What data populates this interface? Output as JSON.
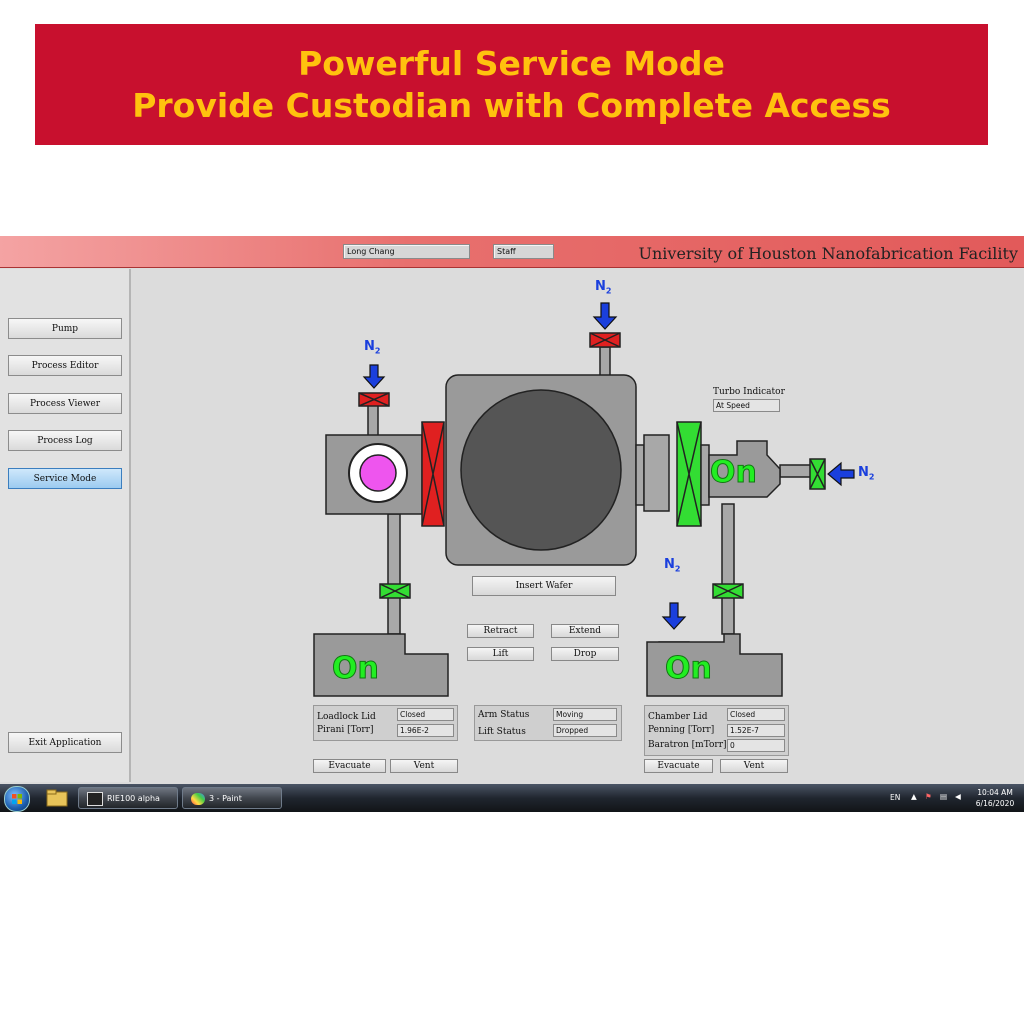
{
  "banner": {
    "line1": "Powerful Service Mode",
    "line2": "Provide Custodian with Complete Access",
    "bg_color": "#c8102e",
    "text_color": "#ffc20e"
  },
  "header": {
    "user_name": "Long Chang",
    "user_role": "Staff",
    "facility": "University of Houston Nanofabrication Facility"
  },
  "sidebar": {
    "items": [
      {
        "label": "Pump",
        "active": false
      },
      {
        "label": "Process Editor",
        "active": false
      },
      {
        "label": "Process Viewer",
        "active": false
      },
      {
        "label": "Process Log",
        "active": false
      },
      {
        "label": "Service Mode",
        "active": true
      }
    ],
    "exit_label": "Exit Application"
  },
  "diagram": {
    "gas_label": "N",
    "gas_subscript": "2",
    "pump_state": "On",
    "turbo_state": "On",
    "turbo_indicator_label": "Turbo Indicator",
    "turbo_indicator_value": "At Speed",
    "colors": {
      "closed_valve": "#e02020",
      "open_valve": "#33dd33",
      "chamber": "#9a9a9a",
      "wafer": "#ee55ee",
      "on_text": "#22ee22",
      "arrow": "#1a3fdd"
    }
  },
  "controls": {
    "insert_wafer": "Insert Wafer",
    "retract": "Retract",
    "extend": "Extend",
    "lift": "Lift",
    "drop": "Drop"
  },
  "loadlock": {
    "lid_label": "Loadlock Lid",
    "lid_value": "Closed",
    "pirani_label": "Pirani [Torr]",
    "pirani_value": "1.96E-2",
    "evacuate": "Evacuate",
    "vent": "Vent"
  },
  "arm": {
    "arm_label": "Arm Status",
    "arm_value": "Moving",
    "lift_label": "Lift Status",
    "lift_value": "Dropped"
  },
  "chamber": {
    "lid_label": "Chamber Lid",
    "lid_value": "Closed",
    "penning_label": "Penning [Torr]",
    "penning_value": "1.52E-7",
    "baratron_label": "Baratron [mTorr]",
    "baratron_value": "0",
    "evacuate": "Evacuate",
    "vent": "Vent"
  },
  "taskbar": {
    "app1": "RIE100 alpha",
    "app2": "3 - Paint",
    "lang": "EN",
    "time": "10:04 AM",
    "date": "6/16/2020"
  }
}
